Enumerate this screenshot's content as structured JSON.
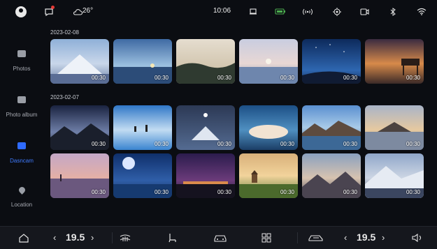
{
  "status": {
    "weather_temp": "26°",
    "time": "10:06"
  },
  "sidebar": {
    "items": [
      {
        "label": "Photos",
        "icon": "photos-icon",
        "active": false
      },
      {
        "label": "Photo album",
        "icon": "album-icon",
        "active": false
      },
      {
        "label": "Dasncam",
        "icon": "dashcam-icon",
        "active": true
      },
      {
        "label": "Location",
        "icon": "location-icon",
        "active": false
      }
    ]
  },
  "groups": [
    {
      "date": "2023-02-08",
      "videos": [
        {
          "duration": "00:30",
          "scene": "snow-mountain"
        },
        {
          "duration": "00:30",
          "scene": "lake-sunset"
        },
        {
          "duration": "00:30",
          "scene": "misty-hills"
        },
        {
          "duration": "00:30",
          "scene": "sea-moon"
        },
        {
          "duration": "00:30",
          "scene": "starry-sky"
        },
        {
          "duration": "00:30",
          "scene": "pier-sunset"
        }
      ]
    },
    {
      "date": "2023-02-07",
      "videos": [
        {
          "duration": "00:30",
          "scene": "milky-way-mountains"
        },
        {
          "duration": "00:30",
          "scene": "salt-flat"
        },
        {
          "duration": "00:30",
          "scene": "moon-peak"
        },
        {
          "duration": "00:30",
          "scene": "clouds-sea"
        },
        {
          "duration": "00:30",
          "scene": "mountain-lake"
        },
        {
          "duration": "00:30",
          "scene": "island-sunset"
        },
        {
          "duration": "00:30",
          "scene": "purple-lake"
        },
        {
          "duration": "00:30",
          "scene": "full-moon-sea"
        },
        {
          "duration": "00:30",
          "scene": "night-city-stars"
        },
        {
          "duration": "00:30",
          "scene": "golden-chapel"
        },
        {
          "duration": "00:30",
          "scene": "dusk-mountains"
        },
        {
          "duration": "00:30",
          "scene": "snowy-ridge"
        }
      ]
    }
  ],
  "bottom_bar": {
    "left_temp": "19.5",
    "right_temp": "19.5"
  },
  "colors": {
    "accent": "#2f6bff",
    "background": "#0b0d12",
    "bar": "#15171d"
  }
}
